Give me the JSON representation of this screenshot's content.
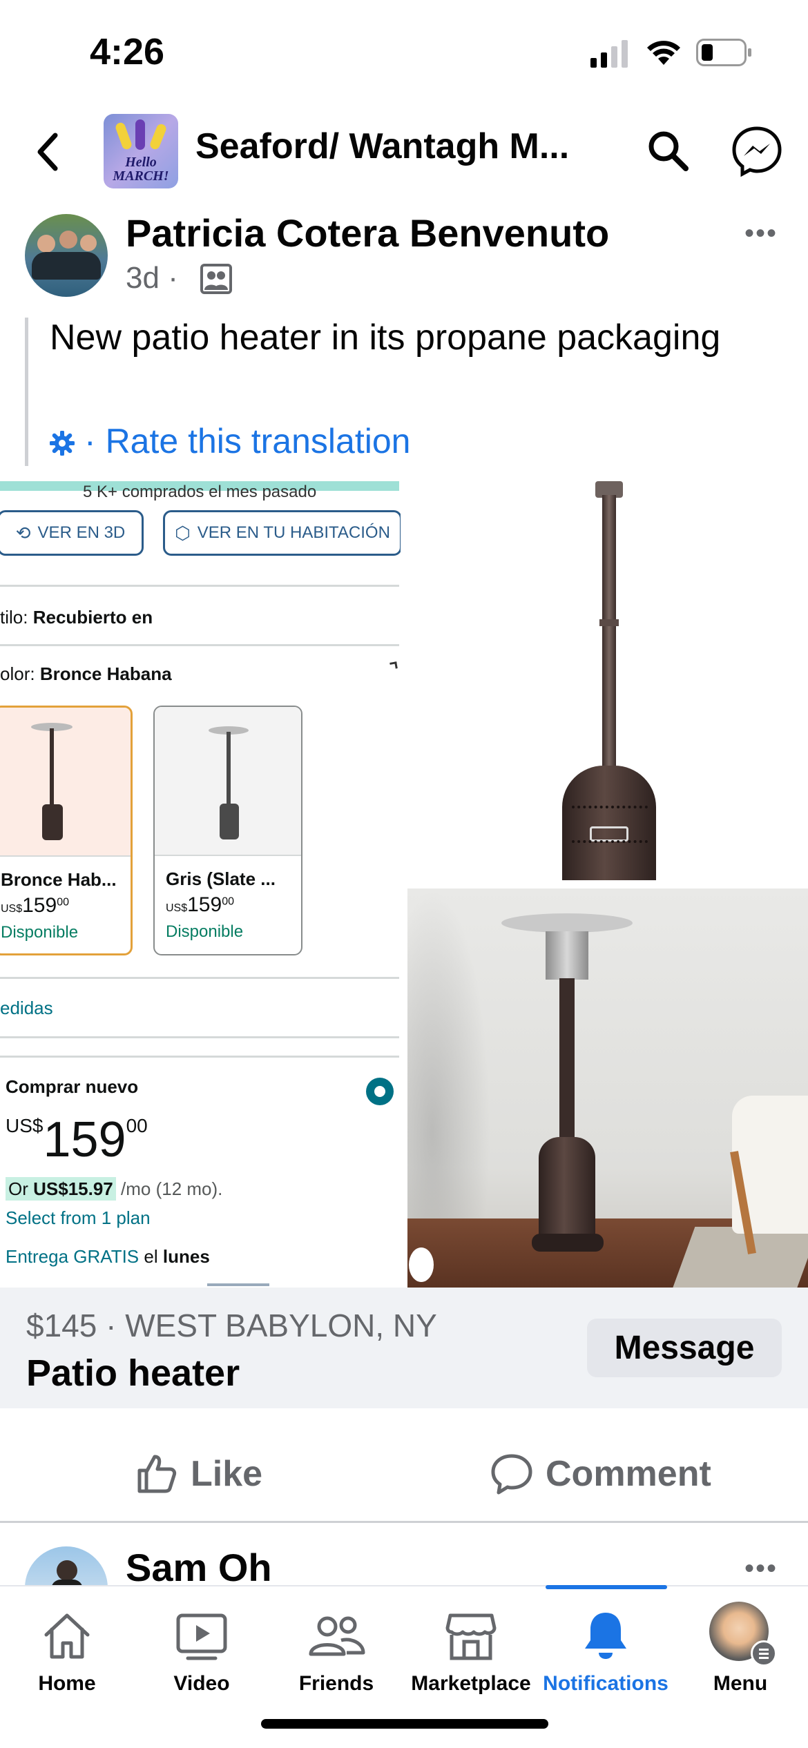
{
  "status_bar": {
    "time": "4:26"
  },
  "header": {
    "group_name": "Seaford/ Wantagh M...",
    "group_thumb_text": "Hello MARCH!"
  },
  "post": {
    "author": "Patricia Cotera Benvenuto",
    "age": "3d",
    "separator": "·",
    "text": "New patio heater in its propane packaging",
    "translation_link": "Rate this translation"
  },
  "screenshot": {
    "banner": "5 K+ comprados el mes pasado",
    "btn_3d": "VER EN 3D",
    "btn_room": "VER EN TU HABITACIÓN",
    "style_label": "tilo:",
    "style_value": "Recubierto en",
    "color_label": "olor:",
    "color_value": "Bronce Habana",
    "options": [
      {
        "name": "Bronce Hab...",
        "currency": "US$",
        "price": "159",
        "cents": "00",
        "availability": "Disponible"
      },
      {
        "name": "Gris (Slate ...",
        "currency": "US$",
        "price": "159",
        "cents": "00",
        "availability": "Disponible"
      }
    ],
    "measures_link": "edidas",
    "buy_new": "Comprar nuevo",
    "big_currency": "US$",
    "big_price": "159",
    "big_cents": "00",
    "installment_prefix": "Or",
    "installment_amount": "US$15.97",
    "installment_suffix": "/mo (12 mo).",
    "plan_link": "Select from 1 plan",
    "delivery_free": "Entrega GRATIS",
    "delivery_mid": "el",
    "delivery_day": "lunes"
  },
  "listing": {
    "price_location": "$145 · WEST BABYLON, NY",
    "title": "Patio heater",
    "message_button": "Message"
  },
  "actions": {
    "like": "Like",
    "comment": "Comment"
  },
  "next_post": {
    "author": "Sam Oh"
  },
  "tabs": [
    {
      "label": "Home",
      "active": false
    },
    {
      "label": "Video",
      "active": false
    },
    {
      "label": "Friends",
      "active": false
    },
    {
      "label": "Marketplace",
      "active": false
    },
    {
      "label": "Notifications",
      "active": true
    },
    {
      "label": "Menu",
      "active": false
    }
  ],
  "colors": {
    "accent": "#1b74e4",
    "muted": "#65676b",
    "bar_bg": "#f0f2f5",
    "amazon_teal": "#007185",
    "amazon_green": "#067d62"
  }
}
